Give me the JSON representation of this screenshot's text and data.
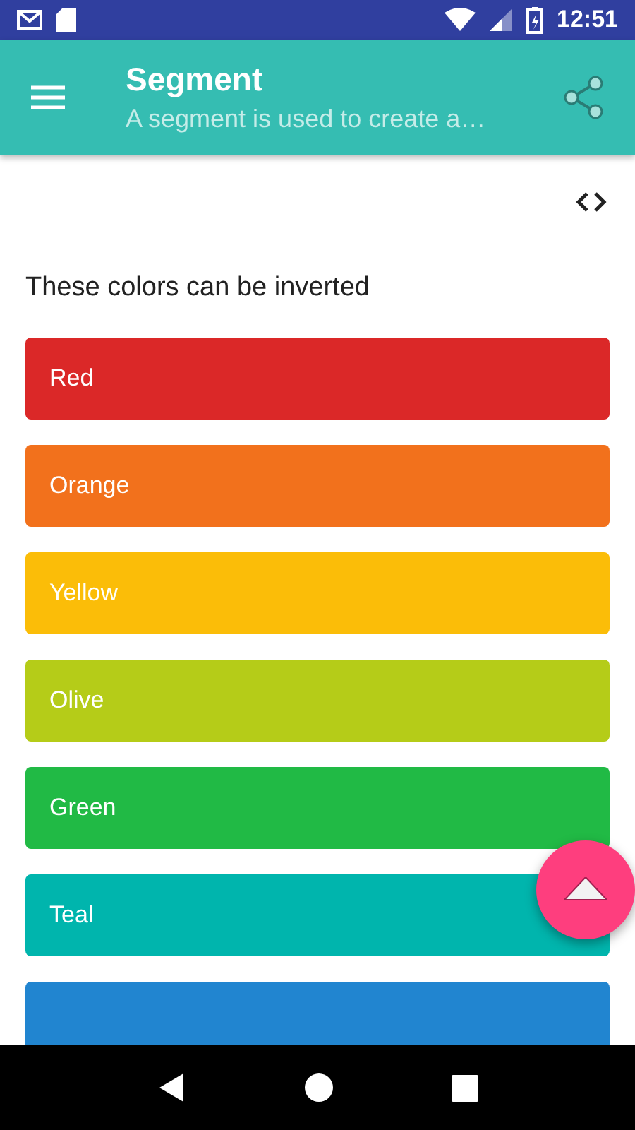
{
  "status_bar": {
    "time": "12:51"
  },
  "app_bar": {
    "title": "Segment",
    "subtitle": "A segment is used to create a…"
  },
  "intro": "These colors can be inverted",
  "segments": [
    {
      "label": "Red",
      "color": "#db2828"
    },
    {
      "label": "Orange",
      "color": "#f2711c"
    },
    {
      "label": "Yellow",
      "color": "#fbbd08"
    },
    {
      "label": "Olive",
      "color": "#b5cc18"
    },
    {
      "label": "Green",
      "color": "#21ba45"
    },
    {
      "label": "Teal",
      "color": "#00b5ad"
    },
    {
      "color": "#2185d0"
    }
  ]
}
